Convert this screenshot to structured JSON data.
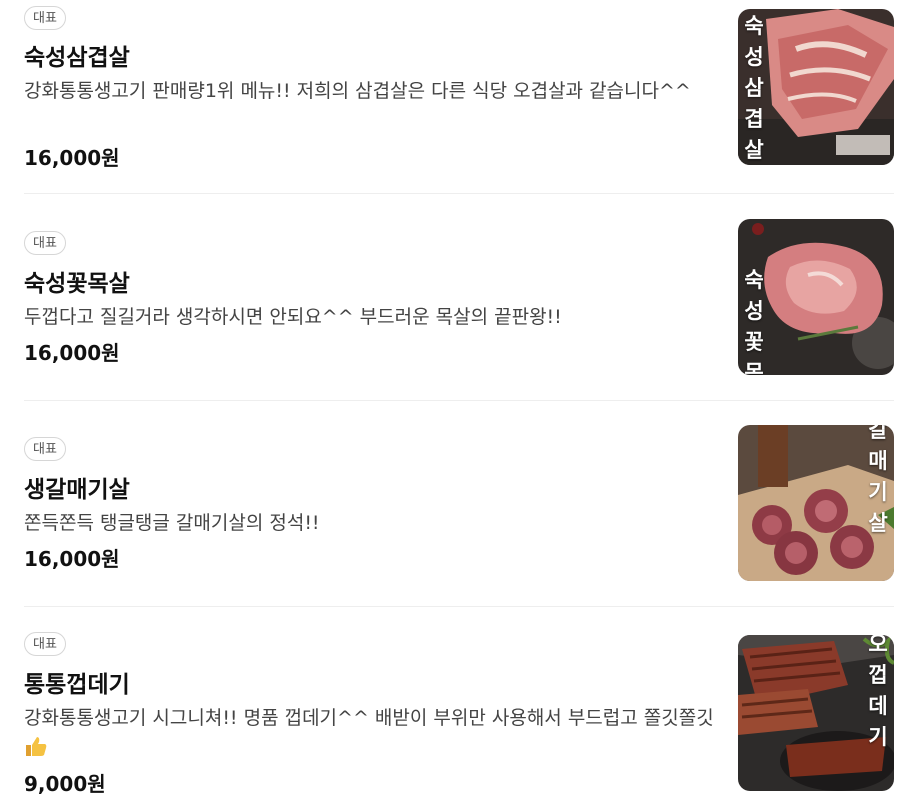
{
  "menu_items": [
    {
      "badge": "대표",
      "name": "숙성삼겹살",
      "description": "강화통통생고기 판매량1위 메뉴!! 저희의 삼겹살은 다른 식당 오겹살과 같습니다^^",
      "price": "16,000원",
      "image_text": "숙성삼겹살"
    },
    {
      "badge": "대표",
      "name": "숙성꽃목살",
      "description": "두껍다고 질길거라 생각하시면 안되요^^ 부드러운 목살의 끝판왕!!",
      "price": "16,000원",
      "image_text": "숙성꽃목살"
    },
    {
      "badge": "대표",
      "name": "생갈매기살",
      "description": "쫀득쫀득 탱글탱글 갈매기살의 정석!!",
      "price": "16,000원",
      "image_text": "갈매기살"
    },
    {
      "badge": "대표",
      "name": "통통껍데기",
      "description": "강화통통생고기 시그니쳐!! 명품 껍데기^^ 배받이 부위만 사용해서 부드럽고 쫄깃쫄깃",
      "price": "9,000원",
      "image_text": "오껍데기"
    }
  ],
  "icons": {
    "thumb": "thumbs-up-icon"
  }
}
